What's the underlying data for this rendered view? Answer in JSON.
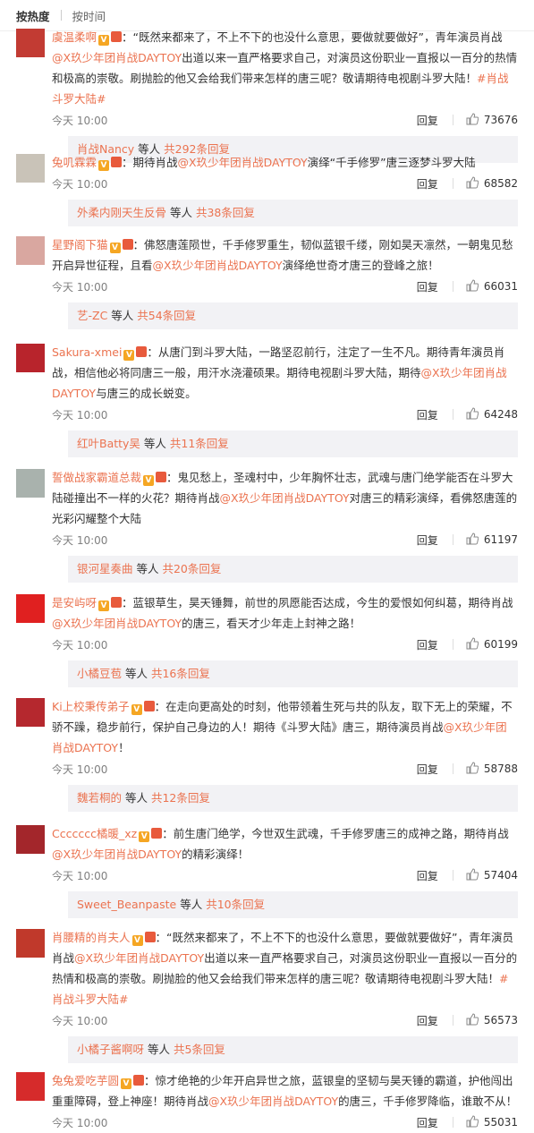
{
  "sort": {
    "hot": "按热度",
    "time": "按时间"
  },
  "comments": [
    {
      "user": "虞温柔啊",
      "avatar_color": "#c23b33",
      "segments": [
        {
          "t": "：“既然来都来了，不上不下的也没什么意思，要做就要做好”，青年演员肖战"
        },
        {
          "m": "@X玖少年团肖战DAYTOY"
        },
        {
          "t": "出道以来一直严格要求自己，对演员这份职业一直报以一百分的热情和极高的崇敬。刷抛脸的他又会给我们带来怎样的唐三呢？敬请期待电视剧斗罗大陆！"
        },
        {
          "m": "#肖战斗罗大陆#"
        }
      ],
      "time": "今天 10:00",
      "reply": "回复",
      "likes": "73676",
      "replies_user": "肖战Nancy",
      "replies_etc": "等人",
      "replies_count": "共292条回复"
    },
    {
      "user": "兔叽霖霖",
      "avatar_color": "#c9c3b8",
      "segments": [
        {
          "t": "：期待肖战"
        },
        {
          "m": "@X玖少年团肖战DAYTOY"
        },
        {
          "t": "演绎“千手修罗”唐三逐梦斗罗大陆"
        }
      ],
      "time": "今天 10:00",
      "reply": "回复",
      "likes": "68582",
      "replies_user": "外柔内刚天生反骨",
      "replies_etc": "等人",
      "replies_count": "共38条回复"
    },
    {
      "user": "星野阁下猫",
      "avatar_color": "#d9a7a0",
      "segments": [
        {
          "t": "：佛怒唐莲陨世，千手修罗重生，韧似蓝银千缕，刚如昊天凛然，一朝鬼见愁开启异世征程，且看"
        },
        {
          "m": "@X玖少年团肖战DAYTOY"
        },
        {
          "t": "演绎绝世奇才唐三的登峰之旅！"
        }
      ],
      "time": "今天 10:00",
      "reply": "回复",
      "likes": "66031",
      "replies_user": "艺-ZC",
      "replies_etc": "等人",
      "replies_count": "共54条回复"
    },
    {
      "user": "Sakura-xmei",
      "avatar_color": "#b8242c",
      "segments": [
        {
          "t": "：从唐门到斗罗大陆，一路坚忍前行，注定了一生不凡。期待青年演员肖战，相信他必将同唐三一般，用汗水浇灌硕果。期待电视剧斗罗大陆，期待"
        },
        {
          "m": "@X玖少年团肖战DAYTOY"
        },
        {
          "t": "与唐三的成长蜕变。"
        }
      ],
      "time": "今天 10:00",
      "reply": "回复",
      "likes": "64248",
      "replies_user": "红叶Batty吴",
      "replies_etc": "等人",
      "replies_count": "共11条回复"
    },
    {
      "user": "誓做战家霸道总裁",
      "avatar_color": "#a9b2ad",
      "segments": [
        {
          "t": "：鬼见愁上，圣魂村中，少年胸怀壮志，武魂与唐门绝学能否在斗罗大陆碰撞出不一样的火花？期待肖战"
        },
        {
          "m": "@X玖少年团肖战DAYTOY"
        },
        {
          "t": "对唐三的精彩演绎，看佛怒唐莲的光彩闪耀整个大陆"
        }
      ],
      "time": "今天 10:00",
      "reply": "回复",
      "likes": "61197",
      "replies_user": "银河星奏曲",
      "replies_etc": "等人",
      "replies_count": "共20条回复"
    },
    {
      "user": "是安屿呀",
      "avatar_color": "#e02020",
      "segments": [
        {
          "t": "：蓝银草生，昊天锤舞，前世的夙愿能否达成，今生的爱恨如何纠葛，期待肖战"
        },
        {
          "m": "@X玖少年团肖战DAYTOY"
        },
        {
          "t": "的唐三，看天才少年走上封神之路！"
        }
      ],
      "time": "今天 10:00",
      "reply": "回复",
      "likes": "60199",
      "replies_user": "小橘豆苞",
      "replies_etc": "等人",
      "replies_count": "共16条回复"
    },
    {
      "user": "Ki上校秉传弟子",
      "avatar_color": "#b5282e",
      "segments": [
        {
          "t": "：在走向更高处的时刻，他带领着生死与共的队友，取下无上的荣耀，不骄不躁，稳步前行，保护自己身边的人！期待《斗罗大陆》唐三，期待演员肖战"
        },
        {
          "m": "@X玖少年团肖战DAYTOY"
        },
        {
          "t": "！"
        }
      ],
      "time": "今天 10:00",
      "reply": "回复",
      "likes": "58788",
      "replies_user": "魏若桐的",
      "replies_etc": "等人",
      "replies_count": "共12条回复"
    },
    {
      "user": "Ccccccc橘暖_xz",
      "avatar_color": "#a3262b",
      "segments": [
        {
          "t": "：前生唐门绝学，今世双生武魂，千手修罗唐三的成神之路，期待肖战"
        },
        {
          "m": "@X玖少年团肖战DAYTOY"
        },
        {
          "t": "的精彩演绎！"
        }
      ],
      "time": "今天 10:00",
      "reply": "回复",
      "likes": "57404",
      "replies_user": "Sweet_Beanpaste",
      "replies_etc": "等人",
      "replies_count": "共10条回复"
    },
    {
      "user": "肖腰精的肖夫人",
      "avatar_color": "#c0392b",
      "segments": [
        {
          "t": "：“既然来都来了，不上不下的也没什么意思，要做就要做好”，青年演员肖战"
        },
        {
          "m": "@X玖少年团肖战DAYTOY"
        },
        {
          "t": "出道以来一直严格要求自己，对演员这份职业一直报以一百分的热情和极高的崇敬。刷抛脸的他又会给我们带来怎样的唐三呢？敬请期待电视剧斗罗大陆！"
        },
        {
          "m": "#肖战斗罗大陆#"
        }
      ],
      "time": "今天 10:00",
      "reply": "回复",
      "likes": "56573",
      "replies_user": "小橘子酱啊呀",
      "replies_etc": "等人",
      "replies_count": "共5条回复"
    },
    {
      "user": "兔兔爱吃芋圆",
      "avatar_color": "#d62b2b",
      "segments": [
        {
          "t": "：惊才绝艳的少年开启异世之旅，蓝银皇的坚韧与昊天锤的霸道，护他闯出重重障碍，登上神座！期待肖战"
        },
        {
          "m": "@X玖少年团肖战DAYTOY"
        },
        {
          "t": "的唐三，千手修罗降临，谁敢不从！"
        }
      ],
      "time": "今天 10:00",
      "reply": "回复",
      "likes": "55031",
      "replies_user": "",
      "replies_etc": "",
      "replies_count": ""
    }
  ]
}
